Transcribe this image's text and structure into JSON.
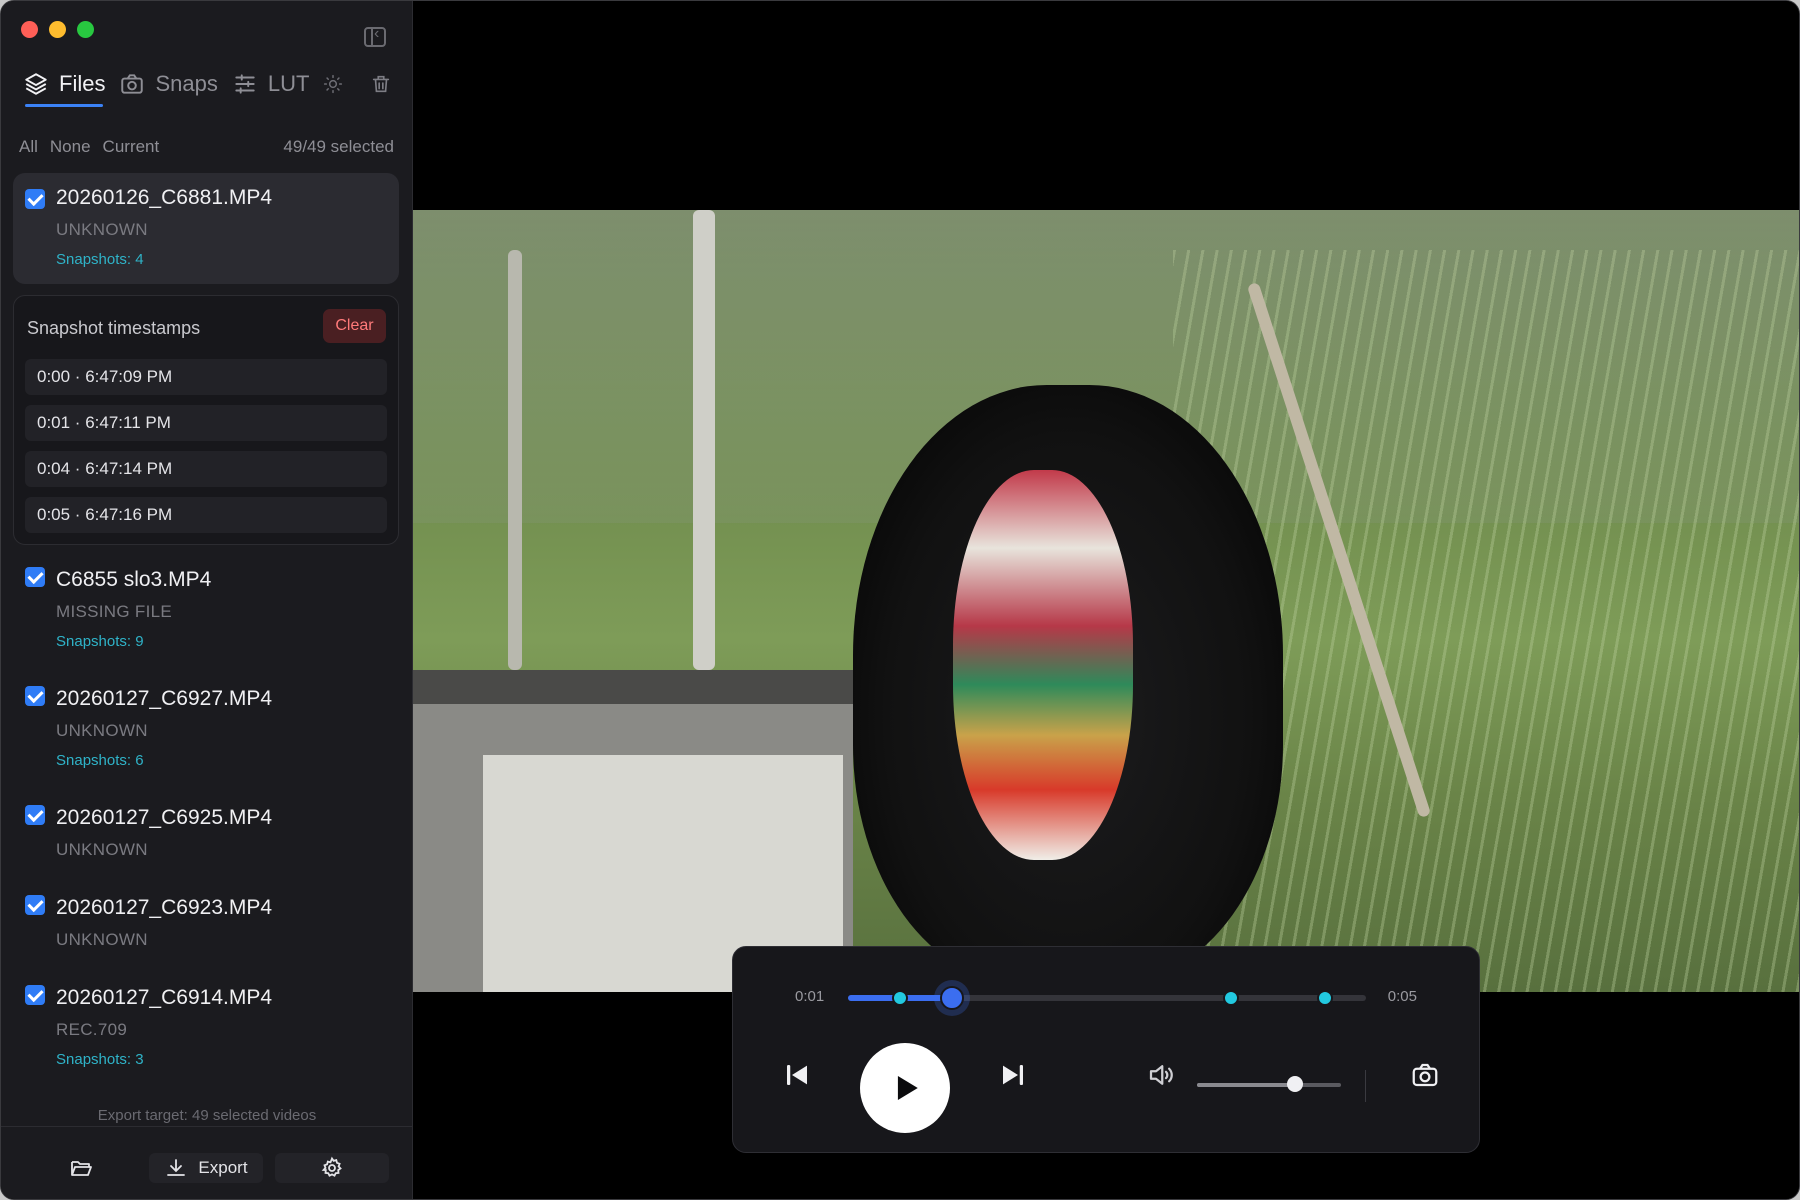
{
  "sidebar": {
    "tabs": [
      {
        "label": "Files",
        "icon": "layers-icon",
        "active": true
      },
      {
        "label": "Snaps",
        "icon": "camera-icon",
        "active": false
      },
      {
        "label": "LUT",
        "icon": "sliders-icon",
        "active": false
      }
    ],
    "extra_icons": [
      "sun-icon",
      "trash-icon",
      "sidebar-toggle-icon"
    ],
    "selection": {
      "all": "All",
      "none": "None",
      "current": "Current",
      "count": "49/49 selected"
    },
    "files": [
      {
        "name": "20260126_C6881.MP4",
        "meta": "UNKNOWN",
        "snapshots": "Snapshots: 4",
        "checked": true,
        "active": true
      },
      {
        "name": "C6855 slo3.MP4",
        "meta": "MISSING FILE",
        "snapshots": "Snapshots: 9",
        "checked": true
      },
      {
        "name": "20260127_C6927.MP4",
        "meta": "UNKNOWN",
        "snapshots": "Snapshots: 6",
        "checked": true
      },
      {
        "name": "20260127_C6925.MP4",
        "meta": "UNKNOWN",
        "snapshots": "",
        "checked": true
      },
      {
        "name": "20260127_C6923.MP4",
        "meta": "UNKNOWN",
        "snapshots": "",
        "checked": true
      },
      {
        "name": "20260127_C6914.MP4",
        "meta": "REC.709",
        "snapshots": "Snapshots: 3",
        "checked": true
      }
    ],
    "snapshot_panel": {
      "title": "Snapshot timestamps",
      "clear_label": "Clear",
      "timestamps": [
        "0:00 · 6:47:09 PM",
        "0:01 · 6:47:11 PM",
        "0:04 · 6:47:14 PM",
        "0:05 · 6:47:16 PM"
      ]
    },
    "export_target": "Export target: 49 selected videos",
    "footer": {
      "export_label": "Export"
    }
  },
  "player": {
    "time_current": "0:01",
    "time_end": "0:05",
    "progress_fraction": 0.2,
    "snapshot_marker_fractions": [
      0.1,
      0.74,
      0.92
    ],
    "volume_fraction": 0.68
  },
  "colors": {
    "accent": "#3b82f6",
    "snapshot_marker": "#22c9e0",
    "snapshots_text": "#2fb3c8",
    "clear_text": "#ff7a7a"
  }
}
